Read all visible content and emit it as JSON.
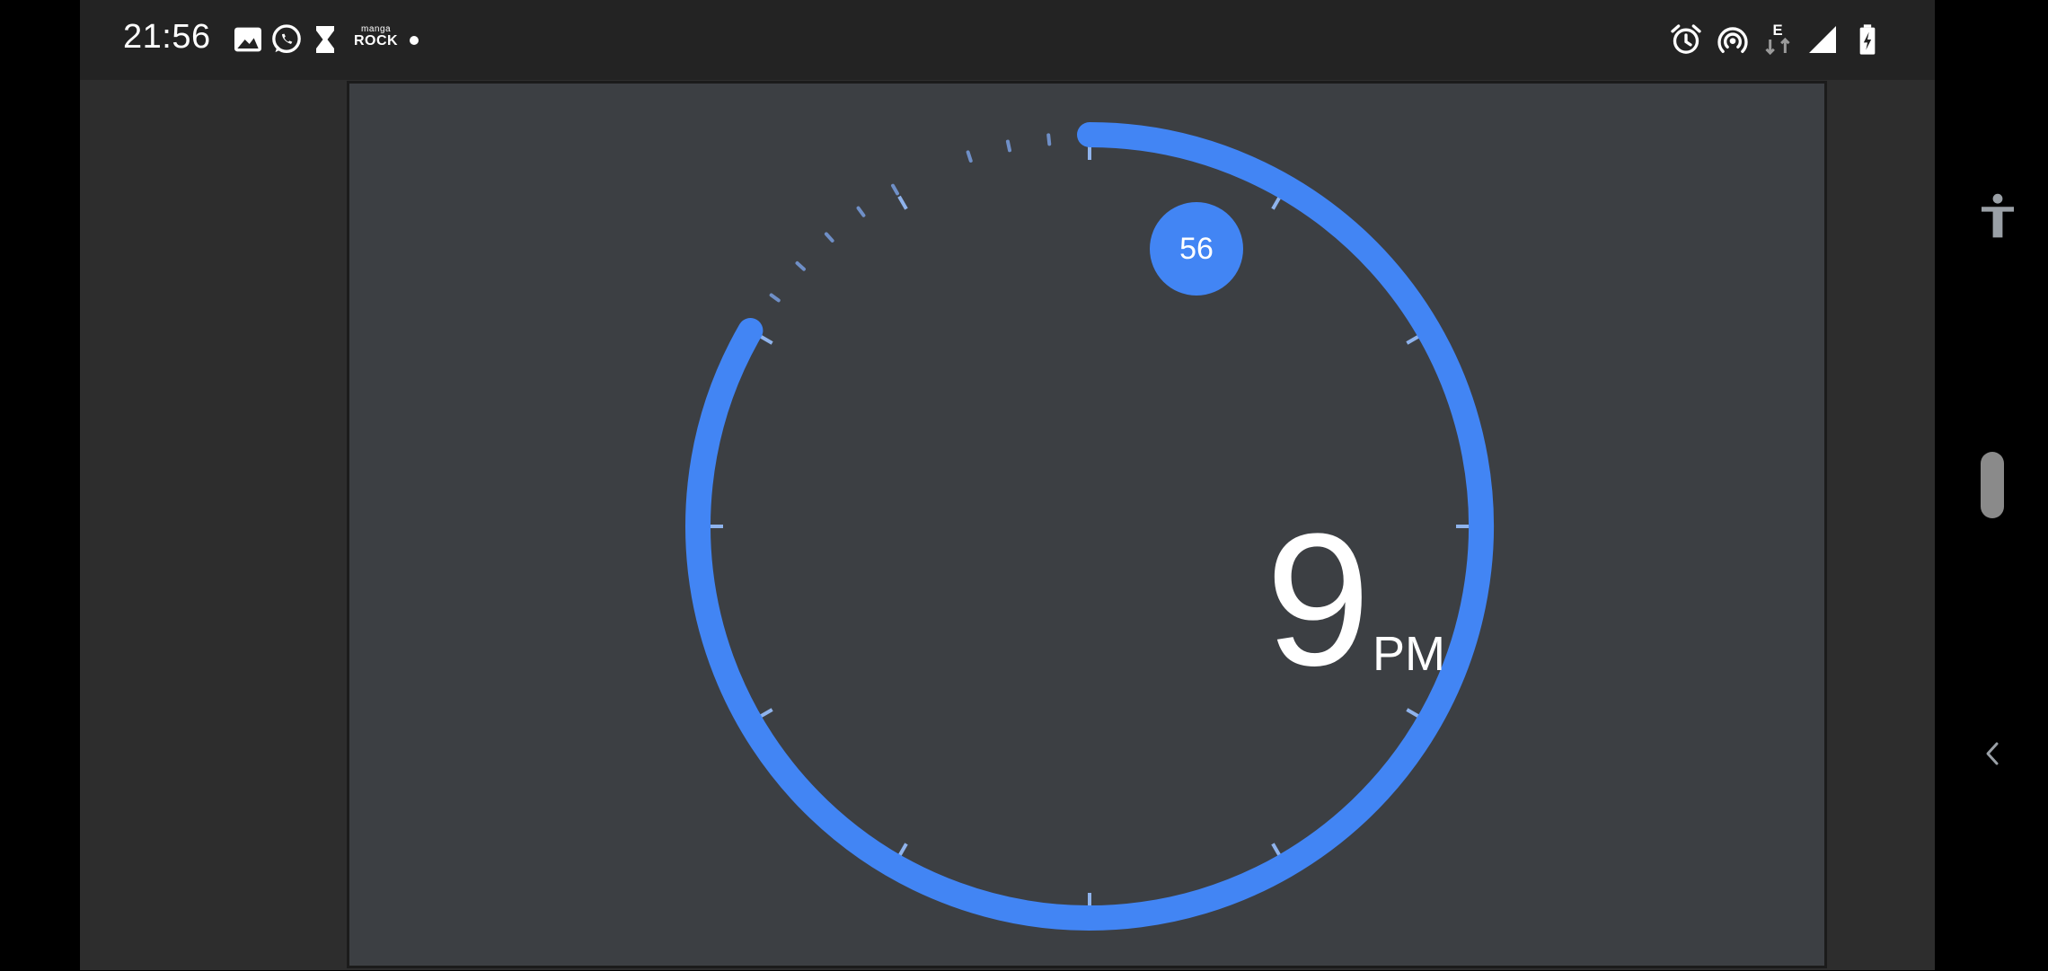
{
  "status_bar": {
    "time": "21:56",
    "left_icons": [
      "gallery-icon",
      "whatsapp-icon",
      "hourglass-icon",
      "manga-rock-icon",
      "notification-dot-icon"
    ],
    "manga_rock": {
      "line1": "manga",
      "line2": "ROCK"
    },
    "right_icons": [
      "alarm-icon",
      "hotspot-icon",
      "data-e-icon",
      "signal-icon",
      "battery-charging-icon"
    ],
    "network_type": "E"
  },
  "timer_dial": {
    "hour": "9",
    "period": "PM",
    "minute_knob": "56",
    "accent_color": "#4285f4"
  },
  "nav_bar": {
    "icons": [
      "accessibility-icon",
      "scroll-handle",
      "back-icon"
    ]
  }
}
